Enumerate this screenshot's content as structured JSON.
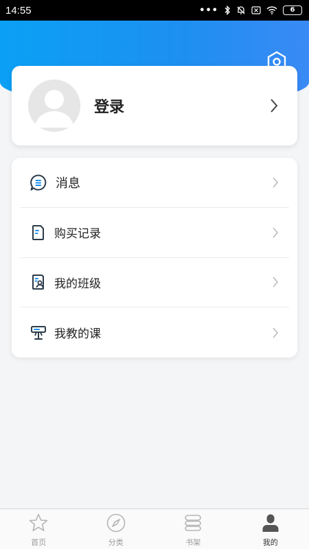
{
  "status_bar": {
    "time": "14:55",
    "battery": "6"
  },
  "profile": {
    "login_label": "登录"
  },
  "menu": {
    "items": [
      {
        "label": "消息",
        "icon": "message-icon"
      },
      {
        "label": "购买记录",
        "icon": "purchase-record-icon"
      },
      {
        "label": "我的班级",
        "icon": "class-icon"
      },
      {
        "label": "我教的课",
        "icon": "teaching-icon"
      }
    ]
  },
  "tabbar": {
    "items": [
      {
        "label": "首页",
        "icon": "star-icon"
      },
      {
        "label": "分类",
        "icon": "compass-icon"
      },
      {
        "label": "书架",
        "icon": "bookshelf-icon"
      },
      {
        "label": "我的",
        "icon": "person-icon",
        "active": true
      }
    ]
  },
  "colors": {
    "header_blue": "#1e8ff2",
    "accent_blue": "#0aa0f5",
    "icon_dark": "#2b3a4a"
  }
}
